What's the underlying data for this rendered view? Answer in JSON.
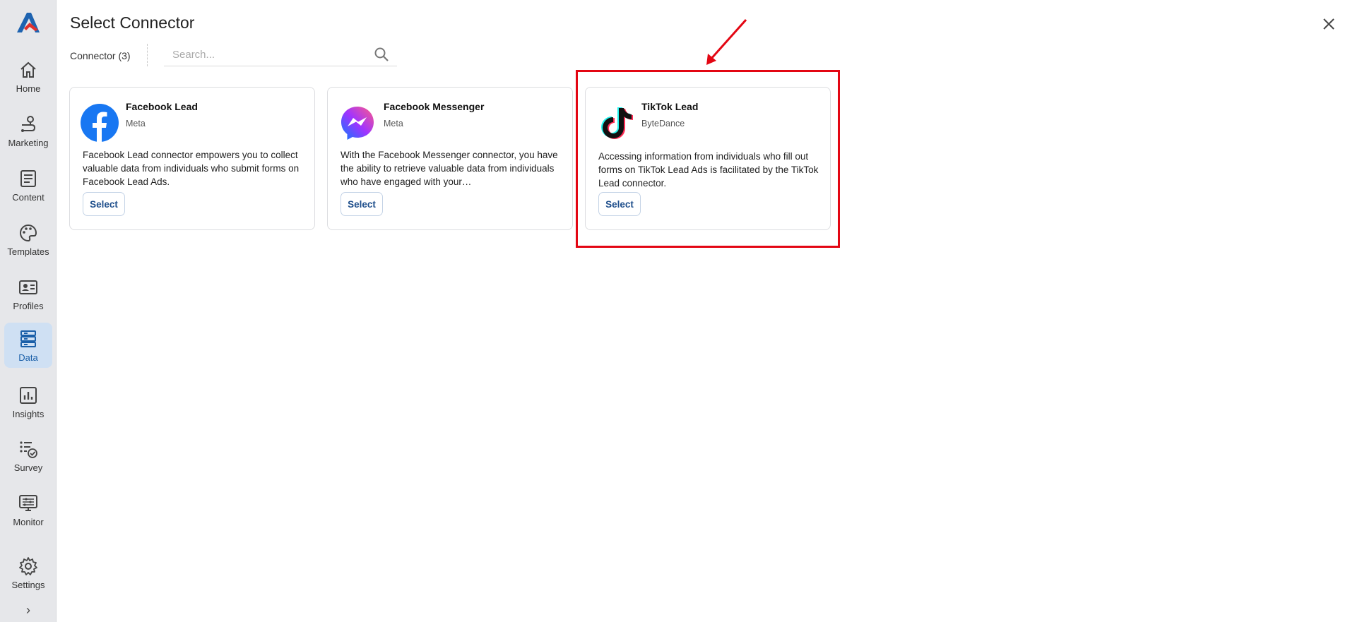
{
  "sidebar": {
    "items": [
      {
        "label": "Home",
        "icon": "home-icon"
      },
      {
        "label": "Marketing",
        "icon": "marketing-icon"
      },
      {
        "label": "Content",
        "icon": "content-icon"
      },
      {
        "label": "Templates",
        "icon": "palette-icon"
      },
      {
        "label": "Profiles",
        "icon": "profiles-icon"
      },
      {
        "label": "Data",
        "icon": "data-icon",
        "active": true
      },
      {
        "label": "Insights",
        "icon": "insights-icon"
      },
      {
        "label": "Survey",
        "icon": "survey-icon"
      },
      {
        "label": "Monitor",
        "icon": "monitor-icon"
      },
      {
        "label": "Settings",
        "icon": "gear-icon"
      }
    ],
    "expand_glyph": "›"
  },
  "header": {
    "title": "Select Connector",
    "count_label": "Connector (3)",
    "search_placeholder": "Search..."
  },
  "connectors": [
    {
      "name": "Facebook Lead",
      "vendor": "Meta",
      "icon": "facebook-icon",
      "description": "Facebook Lead connector empowers you to collect valuable data from individuals who submit forms on Facebook Lead Ads.",
      "button": "Select"
    },
    {
      "name": "Facebook Messenger",
      "vendor": "Meta",
      "icon": "messenger-icon",
      "description": "With the Facebook Messenger connector, you have the ability to retrieve valuable data from individuals who have engaged with your…",
      "button": "Select"
    },
    {
      "name": "TikTok Lead",
      "vendor": "ByteDance",
      "icon": "tiktok-icon",
      "description": "Accessing information from individuals who fill out forms on TikTok Lead Ads is facilitated by the TikTok Lead connector.",
      "button": "Select"
    }
  ],
  "colors": {
    "sidebar_bg": "#e6e7ea",
    "active_bg": "#cfe0f3",
    "accent": "#1f4f8c",
    "annotation_red": "#e30613"
  }
}
